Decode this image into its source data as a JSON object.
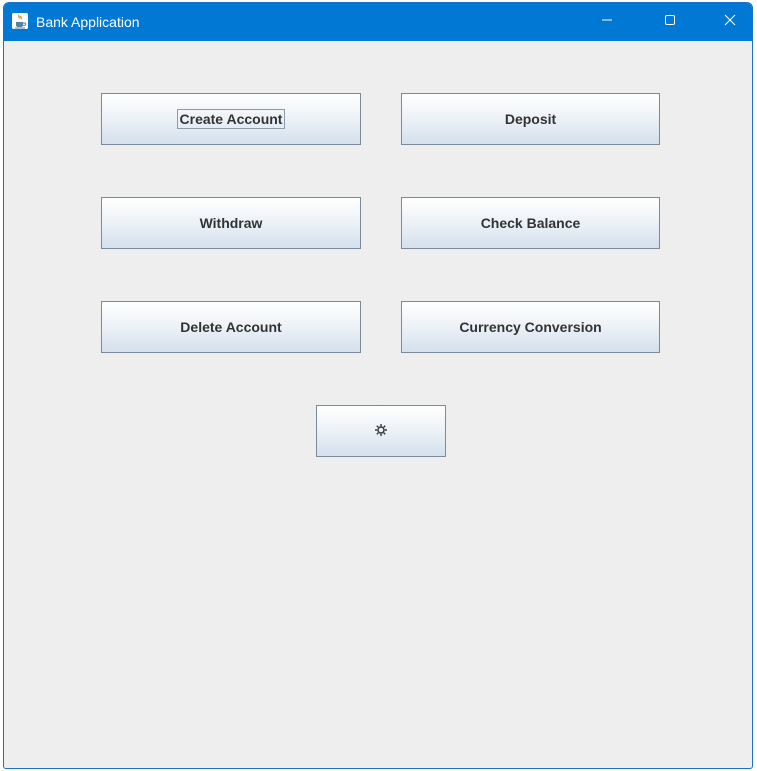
{
  "window": {
    "title": "Bank Application",
    "icon": "java-cup-icon",
    "controls": {
      "minimize_icon": "minimize-icon",
      "maximize_icon": "maximize-icon",
      "close_icon": "close-icon"
    },
    "titlebar_color": "#0078d4",
    "background_color": "#eeeeee"
  },
  "main": {
    "buttons": {
      "create_account": "Create Account",
      "deposit": "Deposit",
      "withdraw": "Withdraw",
      "check_balance": "Check Balance",
      "delete_account": "Delete Account",
      "currency_conversion": "Currency Conversion",
      "settings_icon": "gear-icon"
    },
    "focused_button": "Create Account"
  }
}
